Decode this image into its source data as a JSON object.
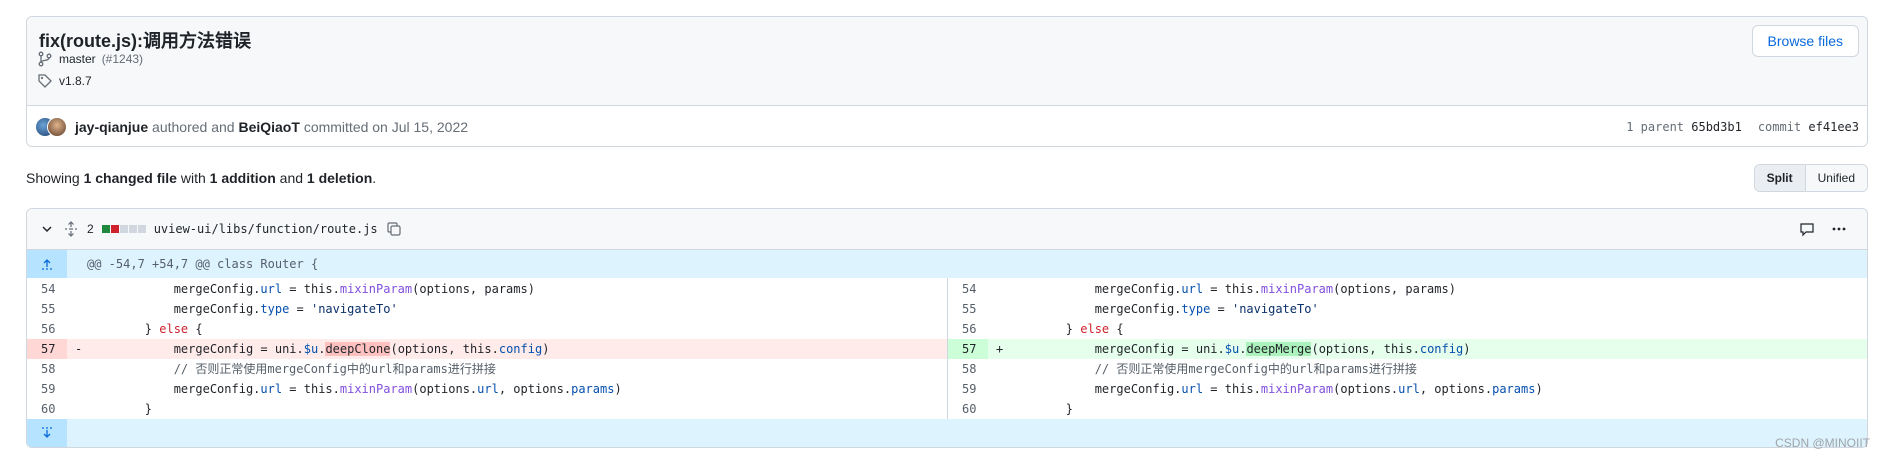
{
  "commit": {
    "title": "fix(route.js):调用方法错误",
    "browse_label": "Browse files",
    "branch": "master",
    "pr": "(#1243)",
    "tag": "v1.8.7",
    "author": "jay-qianjue",
    "authored_text": "authored and",
    "committer": "BeiQiaoT",
    "committed_text": "committed on Jul 15, 2022",
    "parent_label": "1 parent",
    "parent_sha": "65bd3b1",
    "commit_label": "commit",
    "commit_sha": "ef41ee3"
  },
  "summary": {
    "prefix": "Showing",
    "files": "1 changed file",
    "with": "with",
    "additions": "1 addition",
    "and": "and",
    "deletions": "1 deletion",
    "suffix": "."
  },
  "view_toggle": {
    "split": "Split",
    "unified": "Unified",
    "selected": "Split"
  },
  "file": {
    "changes": "2",
    "path": "uview-ui/libs/function/route.js",
    "hunk_header": "@@ -54,7 +54,7 @@ class Router {",
    "stat_colors": {
      "add": "#1f883d",
      "del": "#cf222e",
      "neutral": "#d0d7de"
    }
  },
  "diff": {
    "left": [
      {
        "num": "54",
        "mark": "",
        "type": "ctx",
        "pre": "            mergeConfig.",
        "p1": "url",
        "mid": " = this.",
        "fn": "mixinParam",
        "post": "(options, params)"
      },
      {
        "num": "55",
        "mark": "",
        "type": "ctx",
        "pre": "            mergeConfig.",
        "p1": "type",
        "mid": " = ",
        "str": "'navigateTo'"
      },
      {
        "num": "56",
        "mark": "",
        "type": "ctx",
        "pre": "        } ",
        "kw": "else",
        "post": " {"
      },
      {
        "num": "57",
        "mark": "-",
        "type": "del",
        "pre": "            mergeConfig = uni.",
        "p1": "$u",
        "mid": ".",
        "hl": "deepClone",
        "post": "(options, this.",
        "p2": "config",
        "end": ")"
      },
      {
        "num": "58",
        "mark": "",
        "type": "ctx",
        "cm": "            // 否则正常使用mergeConfig中的url和params进行拼接"
      },
      {
        "num": "59",
        "mark": "",
        "type": "ctx",
        "pre": "            mergeConfig.",
        "p1": "url",
        "mid": " = this.",
        "fn": "mixinParam",
        "post": "(options.",
        "p2": "url",
        "mid2": ", options.",
        "p3": "params",
        "end": ")"
      },
      {
        "num": "60",
        "mark": "",
        "type": "ctx",
        "pre": "        }"
      }
    ],
    "right": [
      {
        "num": "54",
        "mark": "",
        "type": "ctx",
        "pre": "            mergeConfig.",
        "p1": "url",
        "mid": " = this.",
        "fn": "mixinParam",
        "post": "(options, params)"
      },
      {
        "num": "55",
        "mark": "",
        "type": "ctx",
        "pre": "            mergeConfig.",
        "p1": "type",
        "mid": " = ",
        "str": "'navigateTo'"
      },
      {
        "num": "56",
        "mark": "",
        "type": "ctx",
        "pre": "        } ",
        "kw": "else",
        "post": " {"
      },
      {
        "num": "57",
        "mark": "+",
        "type": "add",
        "pre": "            mergeConfig = uni.",
        "p1": "$u",
        "mid": ".",
        "hl": "deepMerge",
        "post": "(options, this.",
        "p2": "config",
        "end": ")"
      },
      {
        "num": "58",
        "mark": "",
        "type": "ctx",
        "cm": "            // 否则正常使用mergeConfig中的url和params进行拼接"
      },
      {
        "num": "59",
        "mark": "",
        "type": "ctx",
        "pre": "            mergeConfig.",
        "p1": "url",
        "mid": " = this.",
        "fn": "mixinParam",
        "post": "(options.",
        "p2": "url",
        "mid2": ", options.",
        "p3": "params",
        "end": ")"
      },
      {
        "num": "60",
        "mark": "",
        "type": "ctx",
        "pre": "        }"
      }
    ]
  },
  "watermark": "CSDN @MINOIIT"
}
